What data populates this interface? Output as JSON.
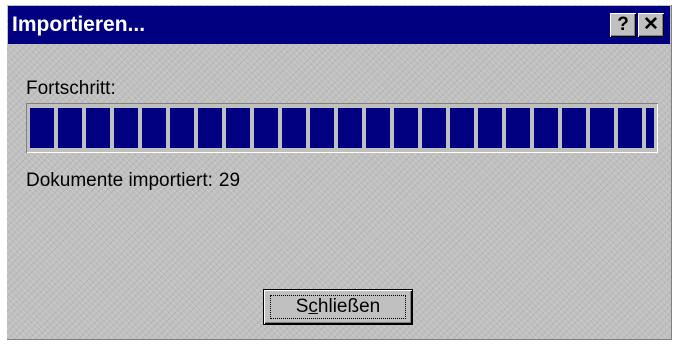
{
  "window": {
    "title": "Importieren...",
    "help_label": "?",
    "close_label": "✕"
  },
  "progress": {
    "label": "Fortschritt:",
    "value_fraction": 1.0
  },
  "status": {
    "label": "Dokumente importiert:",
    "count": "29"
  },
  "button": {
    "close": {
      "pre": "S",
      "mnemonic": "c",
      "post": "hließen"
    }
  },
  "colors": {
    "titlebar": "#000080",
    "dialog_bg": "#c0c0c0",
    "progress_fill": "#000080"
  }
}
